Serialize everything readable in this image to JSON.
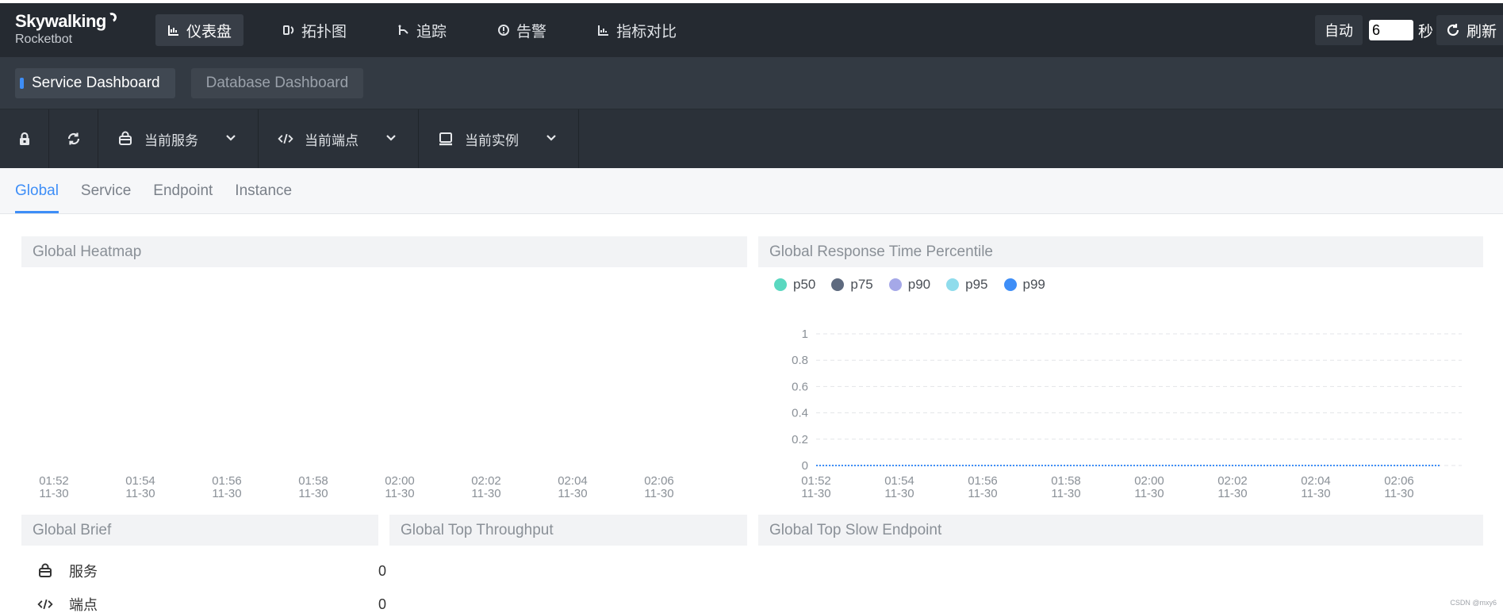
{
  "brand": {
    "name": "Skywalking",
    "sub": "Rocketbot"
  },
  "nav": [
    {
      "label": "仪表盘",
      "icon": "chart-icon",
      "active": true
    },
    {
      "label": "拓扑图",
      "icon": "topology-icon",
      "active": false
    },
    {
      "label": "追踪",
      "icon": "trace-icon",
      "active": false
    },
    {
      "label": "告警",
      "icon": "alarm-icon",
      "active": false
    },
    {
      "label": "指标对比",
      "icon": "compare-icon",
      "active": false
    }
  ],
  "topright": {
    "auto_label": "自动",
    "interval_value": "6",
    "sec_label": "秒",
    "refresh_label": "刷新"
  },
  "dashboards": [
    {
      "label": "Service Dashboard",
      "active": true
    },
    {
      "label": "Database Dashboard",
      "active": false
    }
  ],
  "toolbar": {
    "service_label": "当前服务",
    "endpoint_label": "当前端点",
    "instance_label": "当前实例"
  },
  "tabs": [
    {
      "label": "Global",
      "active": true
    },
    {
      "label": "Service",
      "active": false
    },
    {
      "label": "Endpoint",
      "active": false
    },
    {
      "label": "Instance",
      "active": false
    }
  ],
  "panels": {
    "heatmap": {
      "title": "Global Heatmap"
    },
    "percentile": {
      "title": "Global Response Time Percentile"
    },
    "brief": {
      "title": "Global Brief"
    },
    "throughput": {
      "title": "Global Top Throughput"
    },
    "slow": {
      "title": "Global Top Slow Endpoint"
    }
  },
  "brief_items": [
    {
      "label": "服务",
      "value": "0",
      "icon": "service-icon"
    },
    {
      "label": "端点",
      "value": "0",
      "icon": "endpoint-icon"
    }
  ],
  "colors": {
    "p50": "#5ad8c0",
    "p75": "#5e6a7f",
    "p90": "#a5a8e8",
    "p95": "#8fdcec",
    "p99": "#3e8ef7"
  },
  "watermark": "CSDN @mxy6",
  "chart_data": [
    {
      "type": "heatmap",
      "x": [
        "01:52\n11-30",
        "01:54\n11-30",
        "01:56\n11-30",
        "01:58\n11-30",
        "02:00\n11-30",
        "02:02\n11-30",
        "02:04\n11-30",
        "02:06\n11-30"
      ],
      "values": []
    },
    {
      "type": "line",
      "x": [
        "01:52\n11-30",
        "01:54\n11-30",
        "01:56\n11-30",
        "01:58\n11-30",
        "02:00\n11-30",
        "02:02\n11-30",
        "02:04\n11-30",
        "02:06\n11-30"
      ],
      "yticks": [
        "1",
        "0.8",
        "0.6",
        "0.4",
        "0.2",
        "0"
      ],
      "ylim": [
        0,
        1
      ],
      "series": [
        {
          "name": "p50",
          "values": [
            0,
            0,
            0,
            0,
            0,
            0,
            0,
            0
          ]
        },
        {
          "name": "p75",
          "values": [
            0,
            0,
            0,
            0,
            0,
            0,
            0,
            0
          ]
        },
        {
          "name": "p90",
          "values": [
            0,
            0,
            0,
            0,
            0,
            0,
            0,
            0
          ]
        },
        {
          "name": "p95",
          "values": [
            0,
            0,
            0,
            0,
            0,
            0,
            0,
            0
          ]
        },
        {
          "name": "p99",
          "values": [
            0,
            0,
            0,
            0,
            0,
            0,
            0,
            0
          ]
        }
      ],
      "grid": true,
      "legend": "top-left"
    }
  ]
}
